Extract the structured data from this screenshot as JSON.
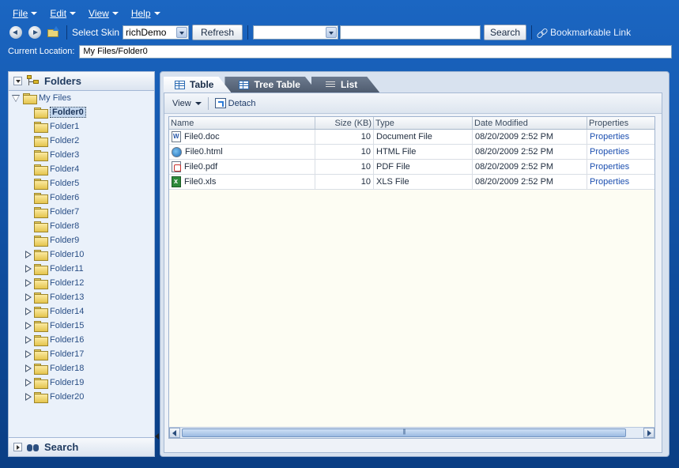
{
  "menu": [
    "File",
    "Edit",
    "View",
    "Help"
  ],
  "toolbar": {
    "skin_label": "Select Skin",
    "skin_value": "richDemo",
    "refresh_label": "Refresh",
    "search_scope_value": "",
    "search_value": "",
    "search_label": "Search",
    "bookmark_label": "Bookmarkable Link"
  },
  "location": {
    "label": "Current Location:",
    "value": "My Files/Folder0"
  },
  "left_panel": {
    "title": "Folders",
    "root": "My Files",
    "folders": [
      {
        "name": "Folder0",
        "selected": true,
        "expandable": false
      },
      {
        "name": "Folder1",
        "expandable": false
      },
      {
        "name": "Folder2",
        "expandable": false
      },
      {
        "name": "Folder3",
        "expandable": false
      },
      {
        "name": "Folder4",
        "expandable": false
      },
      {
        "name": "Folder5",
        "expandable": false
      },
      {
        "name": "Folder6",
        "expandable": false
      },
      {
        "name": "Folder7",
        "expandable": false
      },
      {
        "name": "Folder8",
        "expandable": false
      },
      {
        "name": "Folder9",
        "expandable": false
      },
      {
        "name": "Folder10",
        "expandable": true
      },
      {
        "name": "Folder11",
        "expandable": true
      },
      {
        "name": "Folder12",
        "expandable": true
      },
      {
        "name": "Folder13",
        "expandable": true
      },
      {
        "name": "Folder14",
        "expandable": true
      },
      {
        "name": "Folder15",
        "expandable": true
      },
      {
        "name": "Folder16",
        "expandable": true
      },
      {
        "name": "Folder17",
        "expandable": true
      },
      {
        "name": "Folder18",
        "expandable": true
      },
      {
        "name": "Folder19",
        "expandable": true
      },
      {
        "name": "Folder20",
        "expandable": true
      }
    ],
    "search_title": "Search"
  },
  "tabs": [
    {
      "label": "Table",
      "active": true,
      "icon": "table-icon"
    },
    {
      "label": "Tree Table",
      "active": false,
      "icon": "tree-table-icon"
    },
    {
      "label": "List",
      "active": false,
      "icon": "list-icon"
    }
  ],
  "content_toolbar": {
    "view_label": "View",
    "detach_label": "Detach"
  },
  "table": {
    "columns": [
      "Name",
      "Size (KB)",
      "Type",
      "Date Modified",
      "Properties"
    ],
    "rows": [
      {
        "icon": "doc",
        "name": "File0.doc",
        "size": "10",
        "type": "Document File",
        "date": "08/20/2009 2:52 PM",
        "props": "Properties"
      },
      {
        "icon": "html",
        "name": "File0.html",
        "size": "10",
        "type": "HTML File",
        "date": "08/20/2009 2:52 PM",
        "props": "Properties"
      },
      {
        "icon": "pdf",
        "name": "File0.pdf",
        "size": "10",
        "type": "PDF File",
        "date": "08/20/2009 2:52 PM",
        "props": "Properties"
      },
      {
        "icon": "xls",
        "name": "File0.xls",
        "size": "10",
        "type": "XLS File",
        "date": "08/20/2009 2:52 PM",
        "props": "Properties"
      }
    ]
  }
}
